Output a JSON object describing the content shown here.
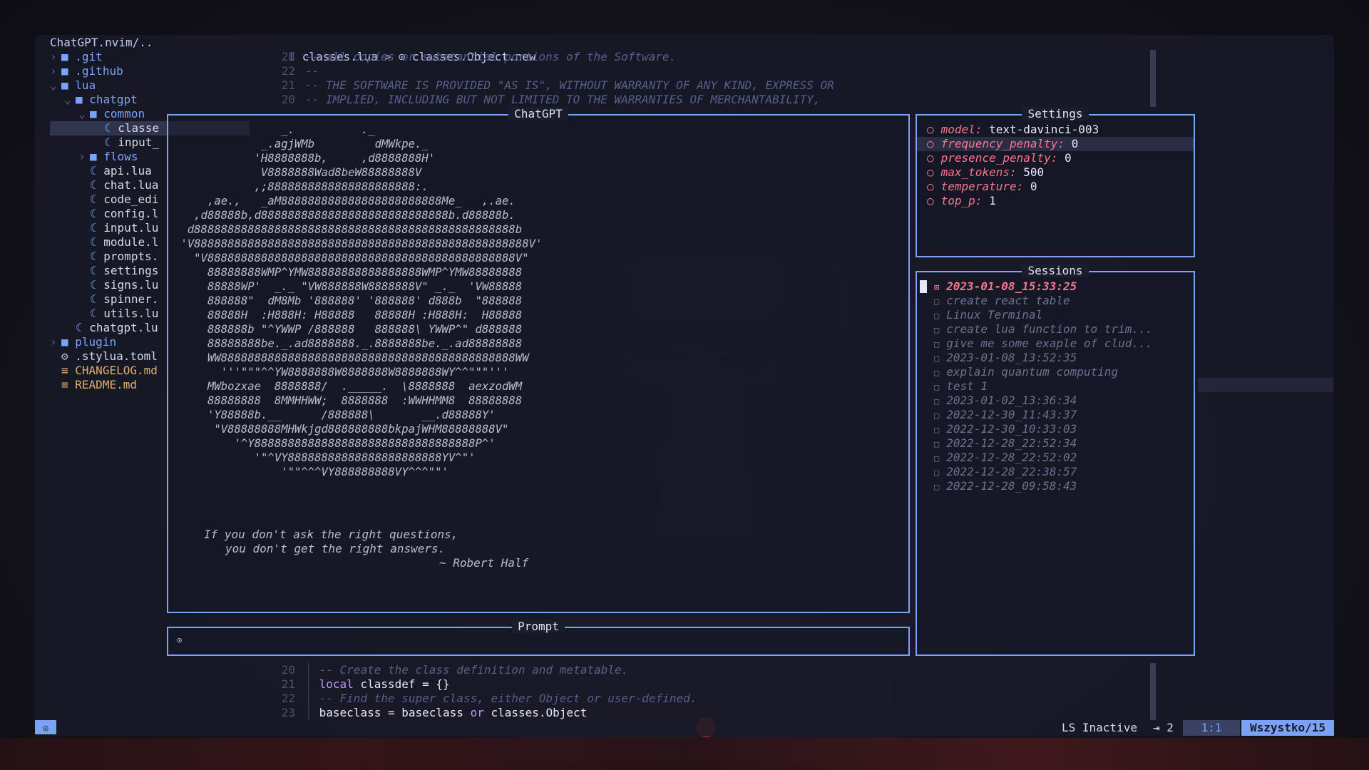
{
  "tree": {
    "root": "ChatGPT.nvim/..",
    "items": [
      {
        "chev": "›",
        "icon": "■",
        "name": ".git",
        "kind": "dir",
        "indent": 0
      },
      {
        "chev": "›",
        "icon": "■",
        "name": ".github",
        "kind": "dir",
        "indent": 0
      },
      {
        "chev": "⌄",
        "icon": "■",
        "name": "lua",
        "kind": "dir",
        "indent": 0
      },
      {
        "chev": "⌄",
        "icon": "■",
        "name": "chatgpt",
        "kind": "dir",
        "indent": 1
      },
      {
        "chev": "⌄",
        "icon": "■",
        "name": "common",
        "kind": "dir",
        "indent": 2
      },
      {
        "chev": "",
        "icon": "☾",
        "name": "classe",
        "kind": "file",
        "indent": 3,
        "selected": true
      },
      {
        "chev": "",
        "icon": "☾",
        "name": "input_",
        "kind": "file",
        "indent": 3
      },
      {
        "chev": "›",
        "icon": "■",
        "name": "flows",
        "kind": "dir",
        "indent": 2
      },
      {
        "chev": "",
        "icon": "☾",
        "name": "api.lua",
        "kind": "file",
        "indent": 2
      },
      {
        "chev": "",
        "icon": "☾",
        "name": "chat.lua",
        "kind": "file",
        "indent": 2
      },
      {
        "chev": "",
        "icon": "☾",
        "name": "code_edi",
        "kind": "file",
        "indent": 2
      },
      {
        "chev": "",
        "icon": "☾",
        "name": "config.l",
        "kind": "file",
        "indent": 2
      },
      {
        "chev": "",
        "icon": "☾",
        "name": "input.lu",
        "kind": "file",
        "indent": 2
      },
      {
        "chev": "",
        "icon": "☾",
        "name": "module.l",
        "kind": "file",
        "indent": 2
      },
      {
        "chev": "",
        "icon": "☾",
        "name": "prompts.",
        "kind": "file",
        "indent": 2
      },
      {
        "chev": "",
        "icon": "☾",
        "name": "settings",
        "kind": "file",
        "indent": 2
      },
      {
        "chev": "",
        "icon": "☾",
        "name": "signs.lu",
        "kind": "file",
        "indent": 2
      },
      {
        "chev": "",
        "icon": "☾",
        "name": "spinner.",
        "kind": "file",
        "indent": 2
      },
      {
        "chev": "",
        "icon": "☾",
        "name": "utils.lu",
        "kind": "file",
        "indent": 2
      },
      {
        "chev": "",
        "icon": "☾",
        "name": "chatgpt.lu",
        "kind": "file",
        "indent": 1
      },
      {
        "chev": "›",
        "icon": "■",
        "name": "plugin",
        "kind": "dir",
        "indent": 0
      },
      {
        "chev": "",
        "icon": "⚙",
        "name": ".stylua.toml",
        "kind": "file",
        "indent": 0
      },
      {
        "chev": "",
        "icon": "≡",
        "name": "CHANGELOG.md",
        "kind": "md",
        "indent": 0
      },
      {
        "chev": "",
        "icon": "≡",
        "name": "README.md",
        "kind": "md",
        "indent": 0
      }
    ]
  },
  "editor": {
    "breadcrumb_file": "classes.lua",
    "breadcrumb_sep": ">",
    "breadcrumb_symbol": "classes.Object.new",
    "top_lines": [
      {
        "n": "23",
        "text": "-- all copies or substantial portions of the Software."
      },
      {
        "n": "22",
        "text": "--"
      },
      {
        "n": "21",
        "text": "-- THE SOFTWARE IS PROVIDED \"AS IS\", WITHOUT WARRANTY OF ANY KIND, EXPRESS OR"
      },
      {
        "n": "20",
        "text": "-- IMPLIED, INCLUDING BUT NOT LIMITED TO THE WARRANTIES OF MERCHANTABILITY,"
      }
    ],
    "bottom_lines": [
      {
        "n": "20",
        "parts": [
          {
            "t": "-- Create the class definition and metatable.",
            "c": "cmt"
          }
        ]
      },
      {
        "n": "21",
        "parts": [
          {
            "t": "local",
            "c": "kw"
          },
          {
            "t": " classdef = {}",
            "c": "ident"
          }
        ]
      },
      {
        "n": "22",
        "parts": [
          {
            "t": "-- Find the super class, either Object or user-defined.",
            "c": "cmt"
          }
        ]
      },
      {
        "n": "23",
        "parts": [
          {
            "t": "baseclass = baseclass ",
            "c": "ident"
          },
          {
            "t": "or",
            "c": "kw"
          },
          {
            "t": " classes.Object",
            "c": "ident"
          }
        ]
      }
    ]
  },
  "chat": {
    "title": "ChatGPT",
    "ascii": "                _.          ._\n             _.agjWMb         dMWkpe._\n            'H8888888b,     ,d8888888H'\n             V8888888Wad8beW88888888V\n            ,;8888888888888888888888:.\n     ,ae.,   _aM888888888888888888888888Me_   ,.ae.\n   ,d88888b,d8888888888888888888888888888b.d88888b.\n  d888888888888888888888888888888888888888888888888b\n 'V88888888888888888888888888888888888888888888888888V'\n   \"V8888888888888888888888888888888888888888888888V\"\n     88888888WMP^YMW88888888888888888WMP^YMW88888888\n     88888WP'  _._ \"VW888888W8888888V\" _._  'VW88888\n     888888\"  dM8Mb '888888' '888888' d888b  \"888888\n     88888H  :H888H: H88888   88888H :H888H:  H88888\n     888888b \"^YWWP /888888   888888\\ YWWP^\" d888888\n     88888888be._.ad8888888._.8888888be._.ad88888888\n     WW88888888888888888888888888888888888888888888WW\n       '''\"\"\"^^YW8888888W8888888W8888888WY^^\"\"\"'''\n     MWbozxae  8888888/  ._____.  \\8888888  aexzodWM\n     88888888  8MMHHWW;  8888888  :WWHHMM8  88888888\n     'Y88888b.__      /888888\\       __.d88888Y'\n      \"V88888888MHWkjgd888888888bkpajWHM88888888V\"\n         '^Y888888888888888888888888888888888P^'\n            '\"^VY88888888888888888888888YV^\"'\n                '\"\"^^^VY888888888VY^^^\"\"'",
    "quote_line1": "If you don't ask the right questions,",
    "quote_line2": "you don't get the right answers.",
    "quote_author": "~ Robert Half"
  },
  "prompt": {
    "title": "Prompt",
    "icon": "⊙"
  },
  "settings": {
    "title": "Settings",
    "items": [
      {
        "key": "model:",
        "value": "text-davinci-003"
      },
      {
        "key": "frequency_penalty:",
        "value": "0",
        "highlight": true
      },
      {
        "key": "presence_penalty:",
        "value": "0"
      },
      {
        "key": "max_tokens:",
        "value": "500"
      },
      {
        "key": "temperature:",
        "value": "0"
      },
      {
        "key": "top_p:",
        "value": "1"
      }
    ]
  },
  "sessions": {
    "title": "Sessions",
    "items": [
      {
        "name": "2023-01-08_15:33:25",
        "active": true
      },
      {
        "name": "create react table"
      },
      {
        "name": "Linux Terminal"
      },
      {
        "name": "create lua function to trim..."
      },
      {
        "name": "give me some exaple of clud..."
      },
      {
        "name": "2023-01-08_13:52:35"
      },
      {
        "name": "explain quantum computing"
      },
      {
        "name": "test 1"
      },
      {
        "name": "2023-01-02_13:36:34"
      },
      {
        "name": "2022-12-30_11:43:37"
      },
      {
        "name": "2022-12-30_10:33:03"
      },
      {
        "name": "2022-12-28_22:52:34"
      },
      {
        "name": "2022-12-28_22:52:02"
      },
      {
        "name": "2022-12-28_22:38:57"
      },
      {
        "name": "2022-12-28_09:58:43"
      }
    ]
  },
  "status": {
    "mode_icon": "◎",
    "ls": "LS Inactive",
    "tab_width": "⇥ 2",
    "position": "1:1",
    "progress": "Wszystko/15"
  },
  "colors": {
    "accent": "#7aa2f7",
    "keyword": "#bb9af7",
    "setting_key": "#f7768e",
    "comment": "#565f89",
    "markdown": "#e0af68"
  }
}
